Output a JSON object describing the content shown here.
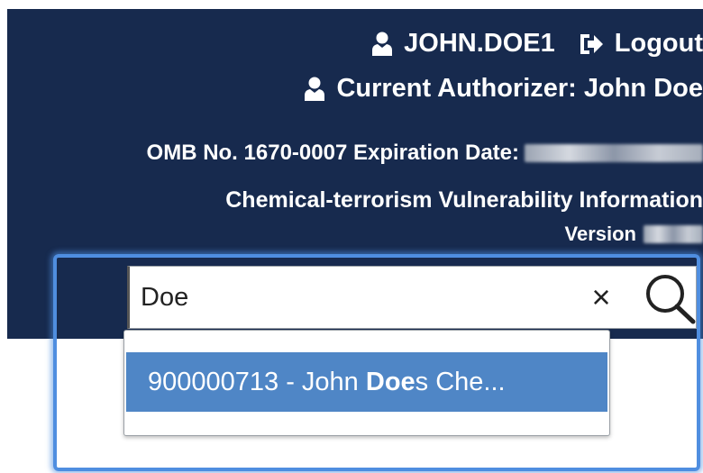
{
  "header": {
    "username": "JOHN.DOE1",
    "logout_label": "Logout",
    "current_authorizer": "Current Authorizer: John Doe",
    "omb_text": "OMB No. 1670-0007 Expiration Date:",
    "app_name": "Chemical-terrorism Vulnerability Information",
    "version_label": "Version"
  },
  "search": {
    "value": "Doe",
    "clear_symbol": "×",
    "suggestions": [
      {
        "prefix": "900000713 - John ",
        "match": "Doe",
        "suffix": "s Che..."
      }
    ]
  },
  "colors": {
    "header_bg": "#172a4e",
    "focus_ring": "#4f8ee0",
    "suggestion_highlight": "#4f86c6"
  }
}
